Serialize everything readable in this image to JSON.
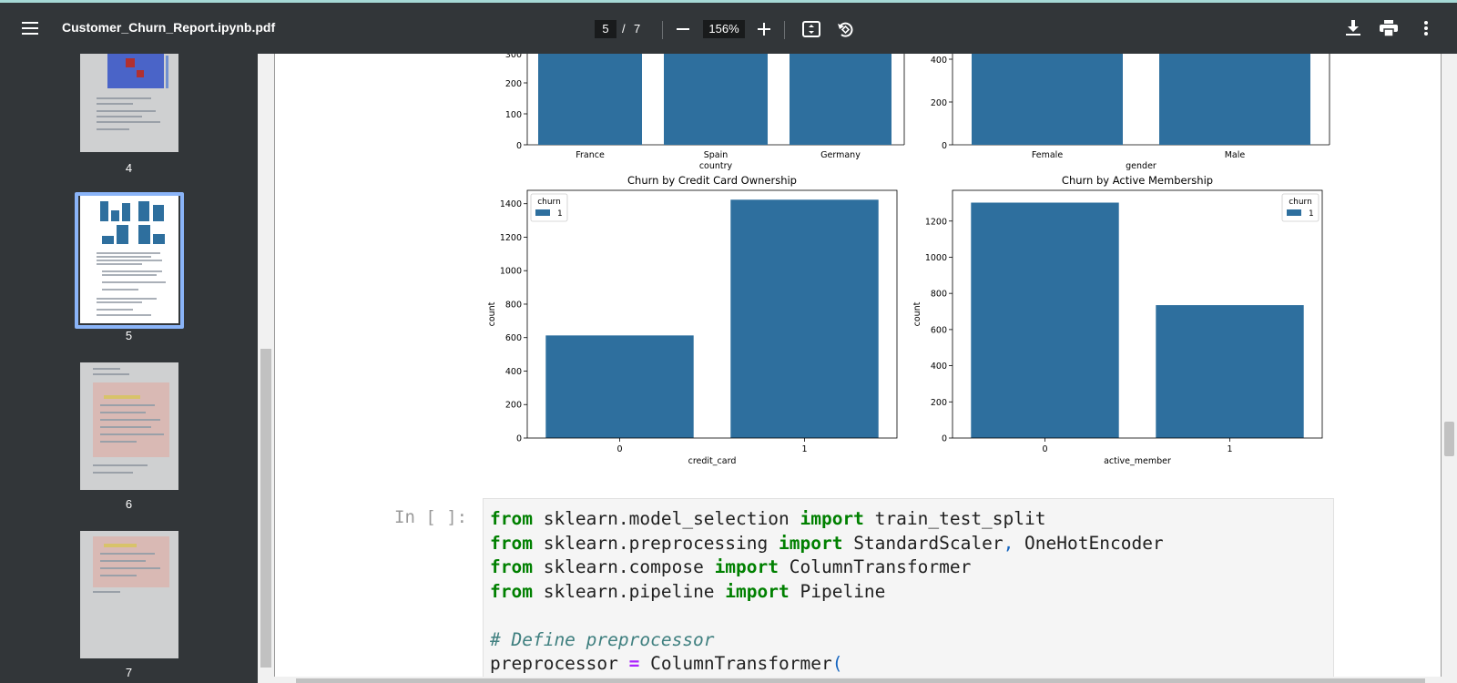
{
  "toolbar": {
    "menu_icon": "hamburger-menu-icon",
    "filename": "Customer_Churn_Report.ipynb.pdf",
    "current_page": "5",
    "page_sep": "/",
    "total_pages": "7",
    "zoom": "156%",
    "icons": [
      "zoom-out-icon",
      "zoom-in-icon",
      "fit-page-icon",
      "rotate-icon",
      "download-icon",
      "print-icon",
      "more-options-icon"
    ]
  },
  "sidebar": {
    "thumbnails": [
      {
        "label": "4"
      },
      {
        "label": "5",
        "selected": true
      },
      {
        "label": "6"
      },
      {
        "label": "7"
      }
    ]
  },
  "charts_top": [
    {
      "xlabel": "country",
      "categories": [
        "France",
        "Spain",
        "Germany"
      ],
      "yticks": [
        "0",
        "100",
        "200",
        "300"
      ]
    },
    {
      "xlabel": "gender",
      "categories": [
        "Female",
        "Male"
      ],
      "yticks": [
        "0",
        "200",
        "400"
      ]
    }
  ],
  "chart_data": [
    {
      "type": "bar",
      "title": "Churn by Credit Card Ownership",
      "xlabel": "credit_card",
      "ylabel": "count",
      "categories": [
        "0",
        "1"
      ],
      "series": [
        {
          "name": "1",
          "values": [
            613,
            1424
          ]
        }
      ],
      "ylim": [
        0,
        1480
      ],
      "yticks": [
        0,
        200,
        400,
        600,
        800,
        1000,
        1200,
        1400
      ],
      "legend_title": "churn",
      "legend": "top-left",
      "color": "#2e6f9e"
    },
    {
      "type": "bar",
      "title": "Churn by Active Membership",
      "xlabel": "active_member",
      "ylabel": "count",
      "categories": [
        "0",
        "1"
      ],
      "series": [
        {
          "name": "1",
          "values": [
            1302,
            735
          ]
        }
      ],
      "ylim": [
        0,
        1370
      ],
      "yticks": [
        0,
        200,
        400,
        600,
        800,
        1000,
        1200
      ],
      "legend_title": "churn",
      "legend": "top-right",
      "color": "#2e6f9e"
    }
  ],
  "code_cell": {
    "prompt": "In [ ]:",
    "lines": [
      [
        "from",
        " sklearn.model_selection ",
        "import",
        " train_test_split"
      ],
      [
        "from",
        " sklearn.preprocessing ",
        "import",
        " StandardScaler",
        ",",
        " OneHotEncoder"
      ],
      [
        "from",
        " sklearn.compose ",
        "import",
        " ColumnTransformer"
      ],
      [
        "from",
        " sklearn.pipeline ",
        "import",
        " Pipeline"
      ],
      [
        "# Define preprocessor"
      ],
      [
        "preprocessor ",
        "=",
        " ColumnTransformer",
        "("
      ]
    ]
  }
}
